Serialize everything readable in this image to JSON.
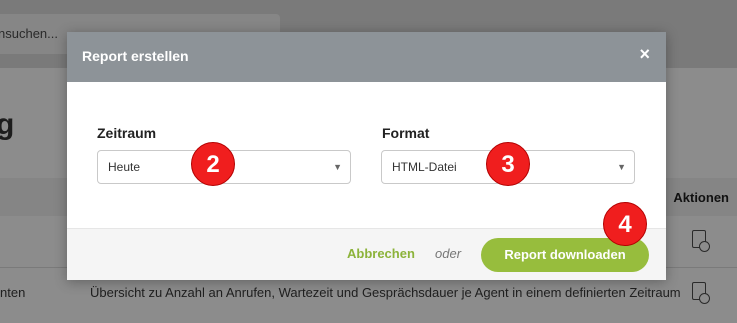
{
  "background": {
    "search_placeholder": "nsuchen...",
    "page_title_fragment": "g",
    "table_header_actions": "Aktionen",
    "row_label_fragment": "nten",
    "row_description": "Übersicht zu Anzahl an Anrufen, Wartezeit und Gesprächsdauer je Agent in einem definierten Zeitraum"
  },
  "modal": {
    "title": "Report erstellen",
    "close_icon": "×",
    "fields": {
      "period": {
        "label": "Zeitraum",
        "value": "Heute"
      },
      "format": {
        "label": "Format",
        "value": "HTML-Datei"
      }
    },
    "footer": {
      "cancel": "Abbrechen",
      "or": "oder",
      "download": "Report downloaden"
    }
  },
  "badges": {
    "b2": "2",
    "b3": "3",
    "b4": "4"
  },
  "colors": {
    "accent_green": "#97bd3d",
    "link_green": "#8cb33a",
    "header_gray": "#8d9398",
    "badge_red": "#f01e1e"
  }
}
